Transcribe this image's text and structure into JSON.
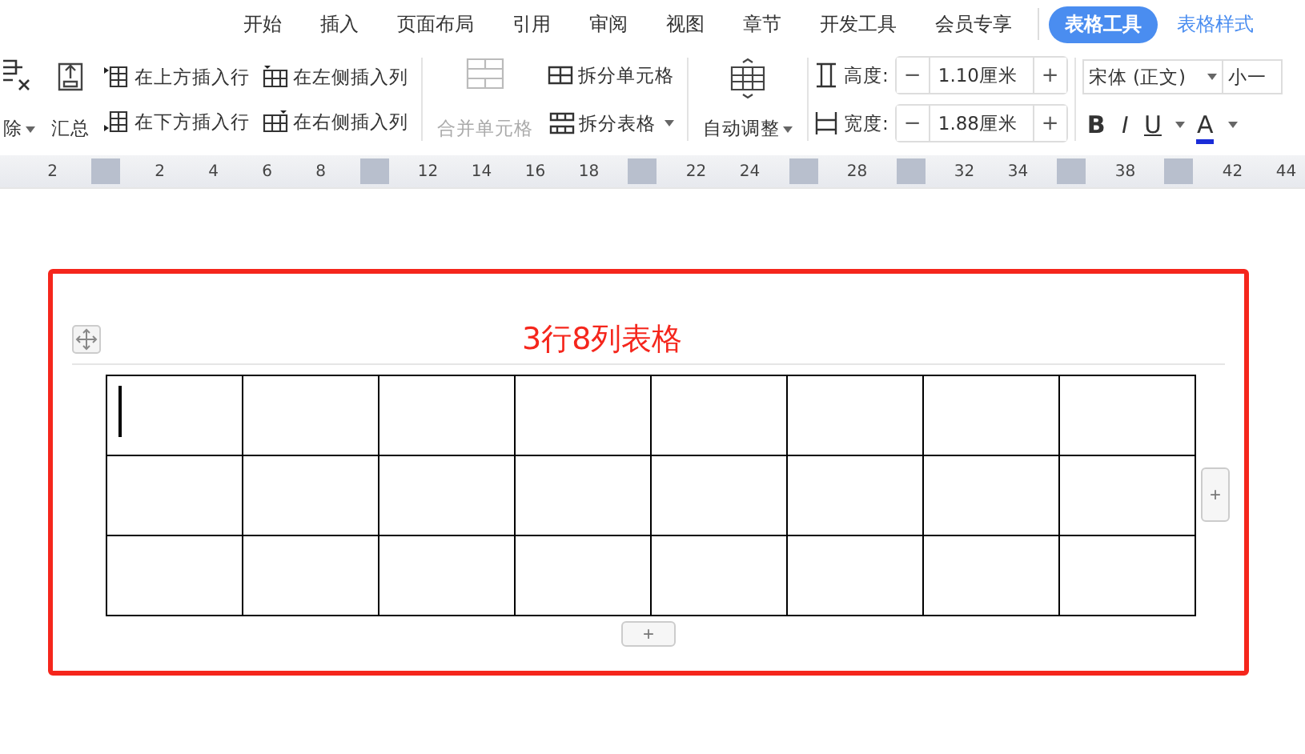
{
  "menu_tabs": [
    {
      "label": "开始",
      "selected": false
    },
    {
      "label": "插入",
      "selected": false
    },
    {
      "label": "页面布局",
      "selected": false
    },
    {
      "label": "引用",
      "selected": false
    },
    {
      "label": "审阅",
      "selected": false
    },
    {
      "label": "视图",
      "selected": false
    },
    {
      "label": "章节",
      "selected": false
    },
    {
      "label": "开发工具",
      "selected": false
    },
    {
      "label": "会员专享",
      "selected": false
    }
  ],
  "context_tabs": [
    {
      "label": "表格工具",
      "selected": true
    },
    {
      "label": "表格样式",
      "selected": false
    }
  ],
  "ribbon": {
    "delete_label": "除",
    "summary_label": "汇总",
    "insert_buttons": [
      {
        "label": "在上方插入行",
        "kind": "row-above"
      },
      {
        "label": "在下方插入行",
        "kind": "row-below"
      },
      {
        "label": "在左侧插入列",
        "kind": "col-left"
      },
      {
        "label": "在右侧插入列",
        "kind": "col-right"
      }
    ],
    "merge": {
      "label": "合并单元格",
      "disabled": true
    },
    "split_cells": "拆分单元格",
    "split_table": "拆分表格",
    "auto_fit": "自动调整",
    "height": {
      "label": "高度:",
      "value": "1.10厘米",
      "minus": "−",
      "plus": "+"
    },
    "width": {
      "label": "宽度:",
      "value": "1.88厘米",
      "minus": "−",
      "plus": "+"
    },
    "font": {
      "value": "宋体 (正文)"
    },
    "size": {
      "value": "小一"
    },
    "format_buttons": [
      {
        "label": "B",
        "kind": "bold"
      },
      {
        "label": "I",
        "kind": "italic"
      },
      {
        "label": "U",
        "kind": "underline"
      },
      {
        "label": "A",
        "kind": "color"
      }
    ]
  },
  "ruler": [
    {
      "kind": "number",
      "label": "2"
    },
    {
      "kind": "marker"
    },
    {
      "kind": "number",
      "label": "2"
    },
    {
      "kind": "number",
      "label": "4"
    },
    {
      "kind": "number",
      "label": "6"
    },
    {
      "kind": "number",
      "label": "8"
    },
    {
      "kind": "marker"
    },
    {
      "kind": "number",
      "label": "12"
    },
    {
      "kind": "number",
      "label": "14"
    },
    {
      "kind": "number",
      "label": "16"
    },
    {
      "kind": "number",
      "label": "18"
    },
    {
      "kind": "marker"
    },
    {
      "kind": "number",
      "label": "22"
    },
    {
      "kind": "number",
      "label": "24"
    },
    {
      "kind": "marker"
    },
    {
      "kind": "number",
      "label": "28"
    },
    {
      "kind": "marker"
    },
    {
      "kind": "number",
      "label": "32"
    },
    {
      "kind": "number",
      "label": "34"
    },
    {
      "kind": "marker"
    },
    {
      "kind": "number",
      "label": "38"
    },
    {
      "kind": "marker"
    },
    {
      "kind": "number",
      "label": "42"
    },
    {
      "kind": "number",
      "label": "44"
    }
  ],
  "document": {
    "title": "3行8列表格",
    "add_column": "+",
    "add_row": "+"
  }
}
